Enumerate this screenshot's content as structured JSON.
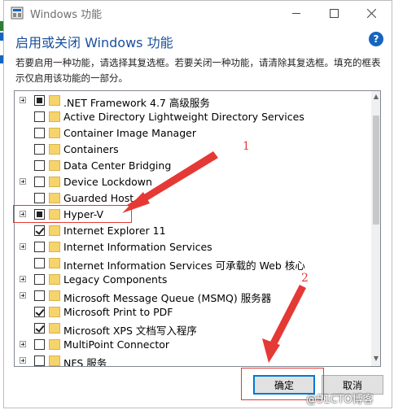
{
  "window": {
    "title": "Windows 功能",
    "heading": "启用或关闭 Windows 功能",
    "help_symbol": "?",
    "description": "若要启用一种功能，请选择其复选框。若要关闭一种功能，请清除其复选框。填充的框表示仅启用该功能的一部分。"
  },
  "features": [
    {
      "label": ".NET Framework 4.7 高级服务",
      "state": "partial",
      "expandable": true
    },
    {
      "label": "Active Directory Lightweight Directory Services",
      "state": "unchecked",
      "expandable": false
    },
    {
      "label": "Container Image Manager",
      "state": "unchecked",
      "expandable": false
    },
    {
      "label": "Containers",
      "state": "unchecked",
      "expandable": false
    },
    {
      "label": "Data Center Bridging",
      "state": "unchecked",
      "expandable": false
    },
    {
      "label": "Device Lockdown",
      "state": "unchecked",
      "expandable": true
    },
    {
      "label": "Guarded Host",
      "state": "unchecked",
      "expandable": false
    },
    {
      "label": "Hyper-V",
      "state": "partial",
      "expandable": true
    },
    {
      "label": "Internet Explorer 11",
      "state": "checked",
      "expandable": false
    },
    {
      "label": "Internet Information Services",
      "state": "unchecked",
      "expandable": true
    },
    {
      "label": "Internet Information Services 可承载的 Web 核心",
      "state": "unchecked",
      "expandable": false
    },
    {
      "label": "Legacy Components",
      "state": "unchecked",
      "expandable": true
    },
    {
      "label": "Microsoft Message Queue (MSMQ) 服务器",
      "state": "unchecked",
      "expandable": true
    },
    {
      "label": "Microsoft Print to PDF",
      "state": "checked",
      "expandable": false
    },
    {
      "label": "Microsoft XPS 文档写入程序",
      "state": "checked",
      "expandable": false
    },
    {
      "label": "MultiPoint Connector",
      "state": "unchecked",
      "expandable": true
    },
    {
      "label": "NFS 服务",
      "state": "unchecked",
      "expandable": true
    }
  ],
  "buttons": {
    "ok": "确定",
    "cancel": "取消"
  },
  "annotations": {
    "label_1": "1",
    "label_2": "2",
    "color": "#e53935"
  },
  "watermark": "@51CTO博客"
}
